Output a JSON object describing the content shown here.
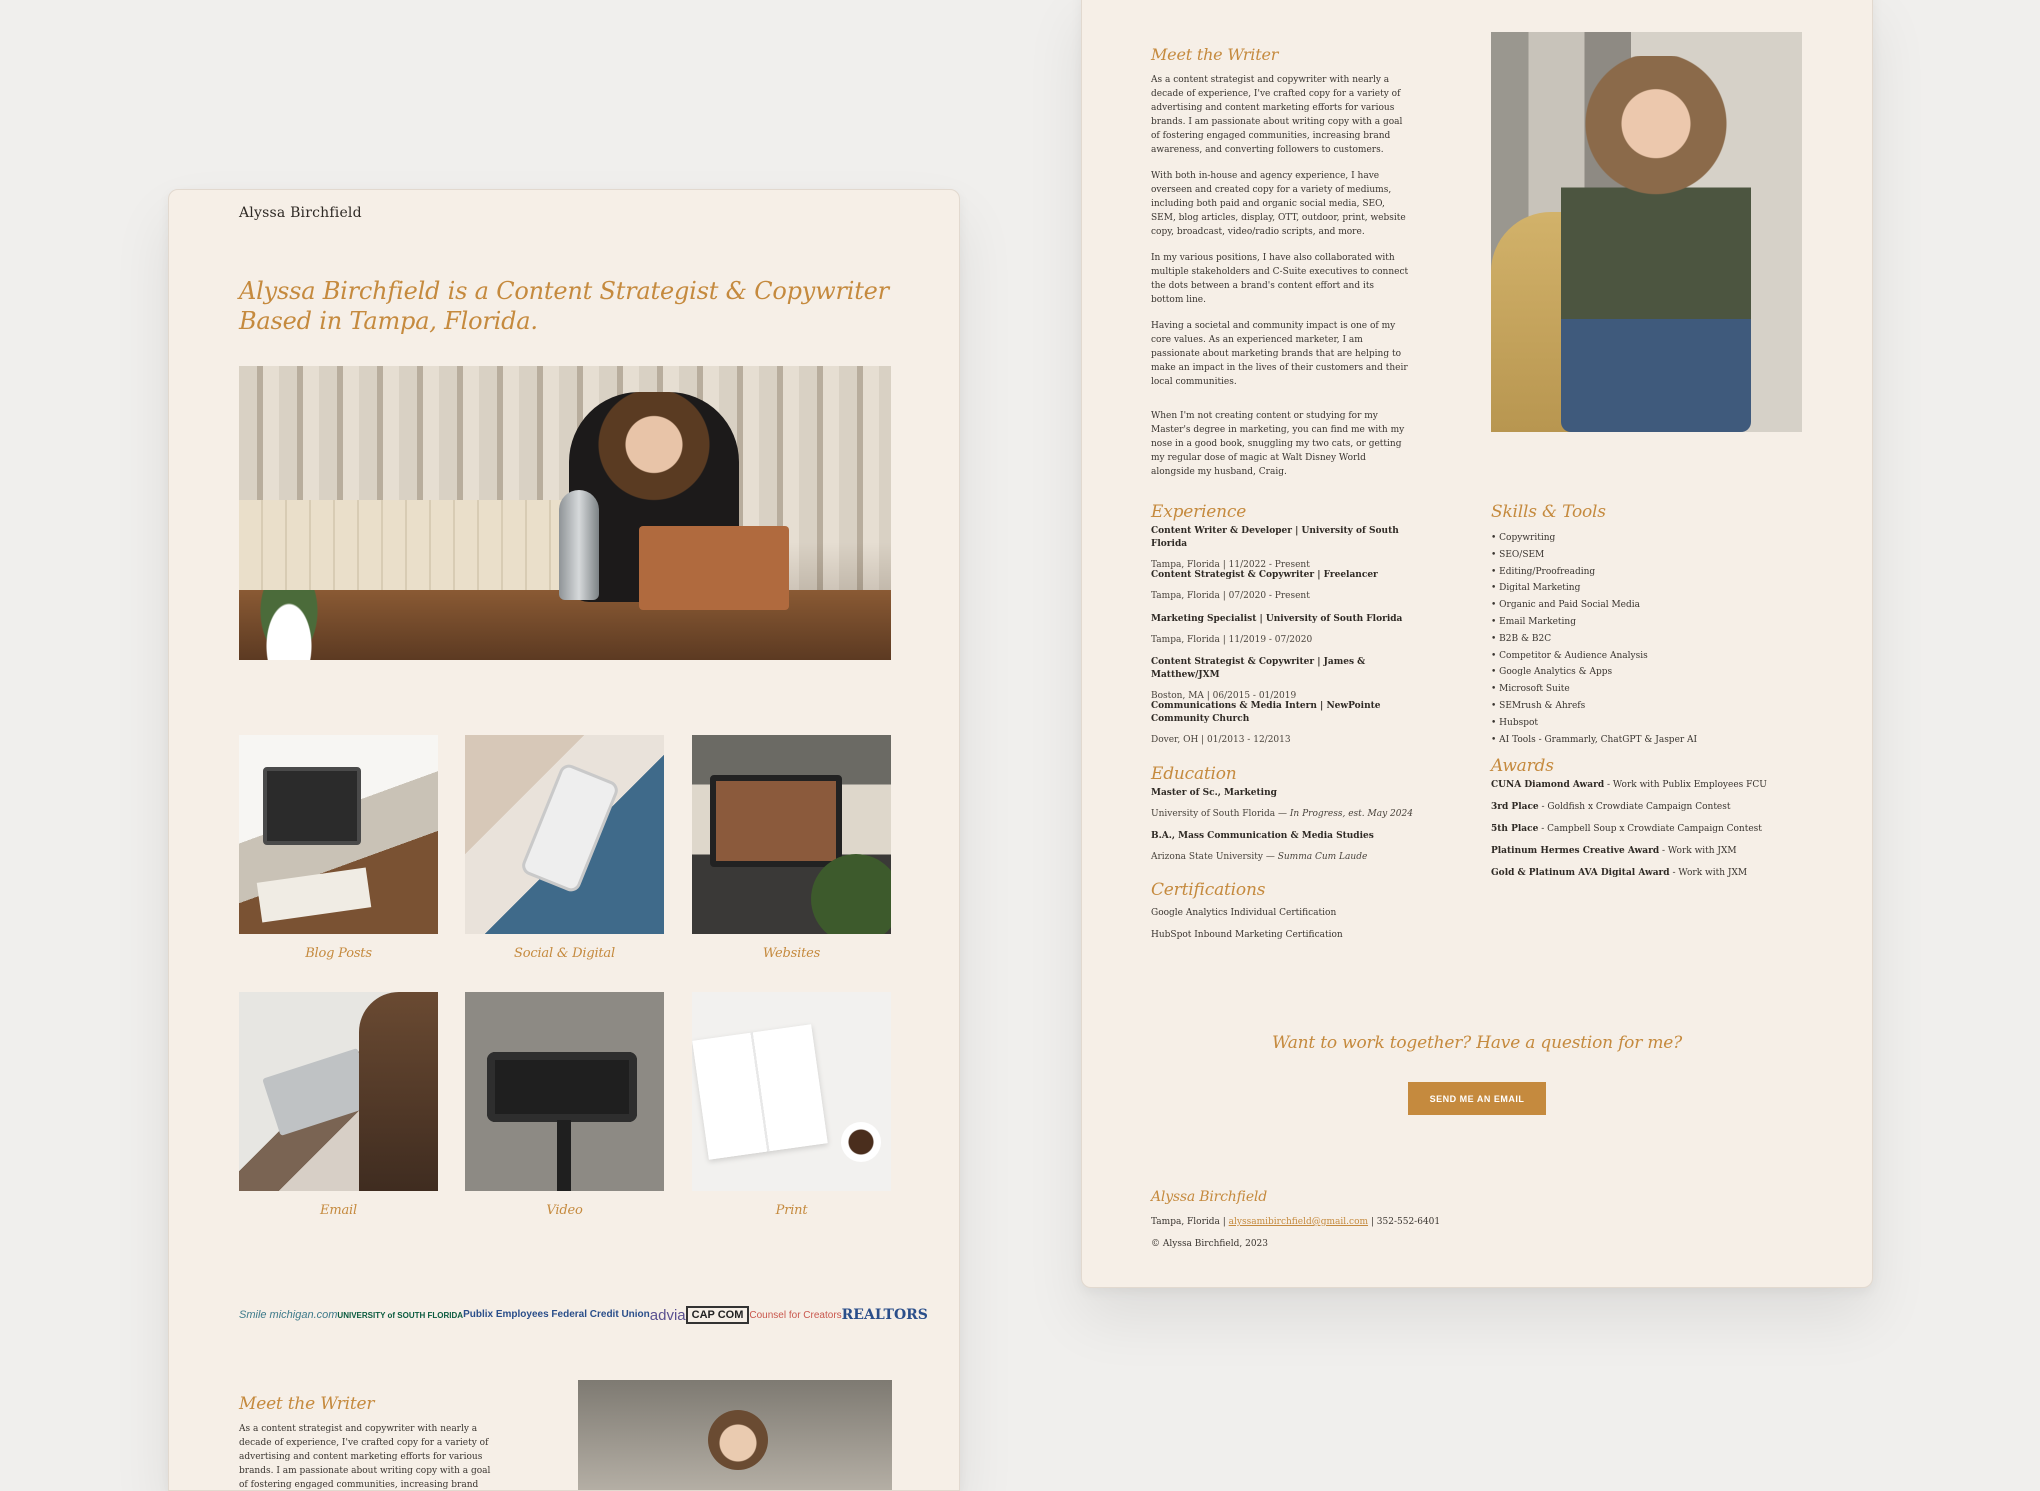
{
  "site_name": "Alyssa Birchfield",
  "hero": {
    "title": "Alyssa Birchfield is a Content Strategist & Copywriter Based in Tampa, Florida."
  },
  "portfolio": [
    {
      "label": "Blog Posts"
    },
    {
      "label": "Social & Digital"
    },
    {
      "label": "Websites"
    },
    {
      "label": "Email"
    },
    {
      "label": "Video"
    },
    {
      "label": "Print"
    }
  ],
  "logos": {
    "smile": "Smile michigan.com",
    "usf": "UNIVERSITY of SOUTH FLORIDA",
    "publix": "Publix Employees Federal Credit Union",
    "advia": "advia",
    "capcom": "CAP COM",
    "counsel": "Counsel for Creators",
    "realtors": "REALTORS"
  },
  "meet": {
    "title": "Meet the Writer",
    "paragraphs": [
      "As a content strategist and copywriter with nearly a decade of experience, I've crafted copy for a variety of advertising and content marketing efforts for various brands. I am passionate about writing copy with a goal of fostering engaged communities, increasing brand awareness, and converting followers to customers.",
      "With both in-house and agency experience, I have overseen and created copy for a variety of mediums, including both paid and organic social media, SEO, SEM, blog articles, display, OTT, outdoor, print, website copy, broadcast, video/radio scripts, and more.",
      "In my various positions, I have also collaborated with multiple stakeholders and C-Suite executives to connect the dots between a brand's content effort and its bottom line.",
      "Having a societal and community impact is one of my core values. As an experienced marketer, I am passionate about marketing brands that are helping to make an impact in the lives of their customers and their local communities.",
      "When I'm not creating content or studying for my Master's degree in marketing, you can find me with my nose in a good book, snuggling my two cats, or getting my regular dose of magic at Walt Disney World alongside my husband, Craig."
    ]
  },
  "experience": {
    "title": "Experience",
    "items": [
      {
        "role": "Content Writer & Developer | University of South Florida",
        "meta": "Tampa, Florida | 11/2022 - Present"
      },
      {
        "role": "Content Strategist & Copywriter | Freelancer",
        "meta": "Tampa, Florida | 07/2020 - Present"
      },
      {
        "role": "Marketing Specialist | University of South Florida",
        "meta": "Tampa, Florida | 11/2019 - 07/2020"
      },
      {
        "role": "Content Strategist & Copywriter | James & Matthew/JXM",
        "meta": "Boston, MA | 06/2015 - 01/2019"
      },
      {
        "role": "Communications & Media Intern | NewPointe Community Church",
        "meta": "Dover, OH | 01/2013 - 12/2013"
      }
    ]
  },
  "education": {
    "title": "Education",
    "items": [
      {
        "degree": "Master of Sc., Marketing",
        "school": "University of South Florida — ",
        "note": "In Progress, est. May 2024"
      },
      {
        "degree": "B.A., Mass Communication & Media Studies",
        "school": "Arizona State University — ",
        "note": "Summa Cum Laude"
      }
    ]
  },
  "certifications": {
    "title": "Certifications",
    "items": [
      "Google Analytics Individual Certification",
      "HubSpot Inbound Marketing Certification"
    ]
  },
  "skills": {
    "title": "Skills & Tools",
    "items": [
      "Copywriting",
      "SEO/SEM",
      "Editing/Proofreading",
      "Digital Marketing",
      "Organic and Paid Social Media",
      "Email Marketing",
      "B2B & B2C",
      "Competitor & Audience Analysis",
      "Google Analytics & Apps",
      "Microsoft Suite",
      "SEMrush & Ahrefs",
      "Hubspot",
      "AI Tools - Grammarly, ChatGPT & Jasper AI"
    ]
  },
  "awards": {
    "title": "Awards",
    "items": [
      {
        "name": "CUNA Diamond Award",
        "detail": " - Work with Publix Employees FCU"
      },
      {
        "name": "3rd Place",
        "detail": " - Goldfish x Crowdiate Campaign Contest"
      },
      {
        "name": "5th Place",
        "detail": " - Campbell Soup x Crowdiate Campaign Contest"
      },
      {
        "name": "Platinum Hermes Creative Award",
        "detail": " - Work with JXM"
      },
      {
        "name": "Gold & Platinum AVA Digital Award",
        "detail": " - Work with JXM"
      }
    ]
  },
  "cta": {
    "question": "Want to work together? Have a question for me?",
    "button": "SEND ME AN EMAIL"
  },
  "footer": {
    "name": "Alyssa Birchfield",
    "location": "Tampa, Florida | ",
    "email": "alyssamibirchfield@gmail.com",
    "phone": " | 352-552-6401",
    "copyright": "© Alyssa Birchfield, 2023"
  },
  "colors": {
    "accent": "#c58a3e",
    "background": "#f6efe7",
    "canvas": "#f0efed"
  }
}
